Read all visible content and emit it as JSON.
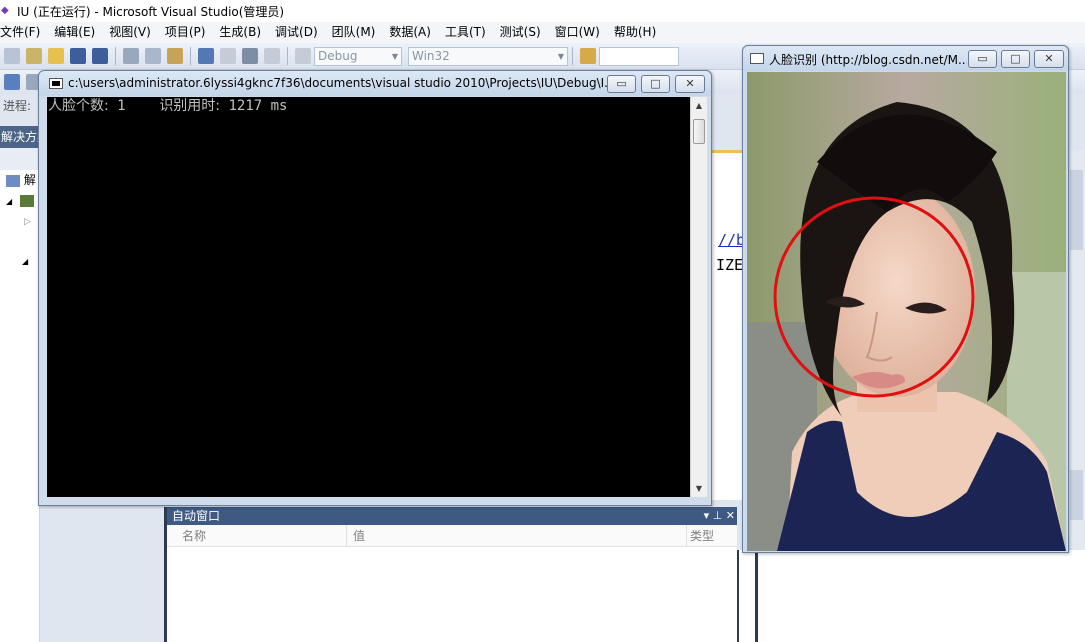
{
  "vs": {
    "title": "IU (正在运行) - Microsoft Visual Studio(管理员)",
    "menu": [
      "文件(F)",
      "编辑(E)",
      "视图(V)",
      "项目(P)",
      "生成(B)",
      "调试(D)",
      "团队(M)",
      "数据(A)",
      "工具(T)",
      "测试(S)",
      "窗口(W)",
      "帮助(H)"
    ],
    "config_combo": "Debug",
    "platform_combo": "Win32",
    "progress_label": "进程:",
    "solution_header": "解决方案",
    "solution_item": "解",
    "code_link_fragment": "//b",
    "code_text_fragment": "IZE",
    "autos": {
      "title": "自动窗口",
      "col_name": "名称",
      "col_value": "值",
      "col_type": "类型"
    }
  },
  "console": {
    "title": "c:\\users\\administrator.6lyssi4gknc7f36\\documents\\visual studio 2010\\Projects\\IU\\Debug\\I...",
    "label_count": "人脸个数:",
    "count": "1",
    "label_time": "识别用时:",
    "time": "1217 ms"
  },
  "face_window": {
    "title": "人脸识别 (http://blog.csdn.net/M..."
  },
  "colors": {
    "detection_circle": "#e01010",
    "console_bg": "#000000",
    "console_text": "#c0c0c0"
  }
}
